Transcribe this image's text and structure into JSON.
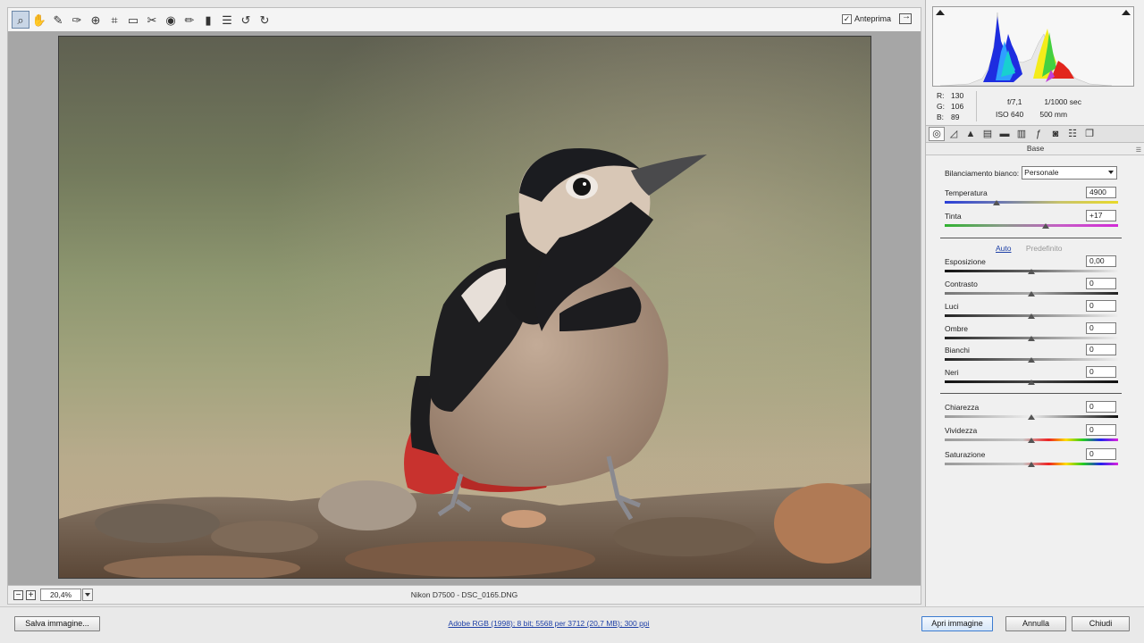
{
  "toolbar": {
    "tools": [
      {
        "name": "zoom-tool-icon",
        "glyph": "⌕",
        "active": true
      },
      {
        "name": "hand-tool-icon",
        "glyph": "✋"
      },
      {
        "name": "white-balance-tool-icon",
        "glyph": "✎"
      },
      {
        "name": "color-sampler-tool-icon",
        "glyph": "✑"
      },
      {
        "name": "targeted-adjustment-tool-icon",
        "glyph": "⊕"
      },
      {
        "name": "crop-tool-icon",
        "glyph": "⌗"
      },
      {
        "name": "straighten-tool-icon",
        "glyph": "▭"
      },
      {
        "name": "spot-removal-tool-icon",
        "glyph": "✂"
      },
      {
        "name": "red-eye-removal-tool-icon",
        "glyph": "◉"
      },
      {
        "name": "adjustment-brush-tool-icon",
        "glyph": "✏"
      },
      {
        "name": "graduated-filter-tool-icon",
        "glyph": "▮"
      },
      {
        "name": "preferences-icon",
        "glyph": "☰"
      },
      {
        "name": "rotate-left-icon",
        "glyph": "↺"
      },
      {
        "name": "rotate-right-icon",
        "glyph": "↻"
      }
    ],
    "preview_label": "Anteprima",
    "preview_checked": "✓"
  },
  "status": {
    "zoom_out": "−",
    "zoom_in": "+",
    "zoom_value": "20,4%",
    "file_caption": "Nikon D7500  -  DSC_0165.DNG"
  },
  "histogram": {
    "r_label": "R:",
    "r_value": "130",
    "g_label": "G:",
    "g_value": "106",
    "b_label": "B:",
    "b_value": "89",
    "aperture": "f/7,1",
    "shutter": "1/1000 sec",
    "iso": "ISO 640",
    "focal": "500 mm"
  },
  "panel_tabs": [
    {
      "name": "basic-tab-icon",
      "glyph": "◎",
      "active": true
    },
    {
      "name": "tone-curve-tab-icon",
      "glyph": "◿"
    },
    {
      "name": "detail-tab-icon",
      "glyph": "▲"
    },
    {
      "name": "hsl-tab-icon",
      "glyph": "▤"
    },
    {
      "name": "split-toning-tab-icon",
      "glyph": "▬"
    },
    {
      "name": "lens-corrections-tab-icon",
      "glyph": "▥"
    },
    {
      "name": "effects-tab-icon",
      "glyph": "ƒ"
    },
    {
      "name": "camera-calibration-tab-icon",
      "glyph": "◙"
    },
    {
      "name": "presets-tab-icon",
      "glyph": "☷"
    },
    {
      "name": "snapshots-tab-icon",
      "glyph": "❐"
    }
  ],
  "panel": {
    "title": "Base",
    "menu_glyph": "☰",
    "wb_label": "Bilanciamento bianco:",
    "wb_value": "Personale",
    "auto_label": "Auto",
    "default_label": "Predefinito"
  },
  "sliders": {
    "temperatura": {
      "label": "Temperatura",
      "value": "4900",
      "position": 0.3
    },
    "tinta": {
      "label": "Tinta",
      "value": "+17",
      "position": 0.58
    },
    "esposizione": {
      "label": "Esposizione",
      "value": "0,00",
      "position": 0.5
    },
    "contrasto": {
      "label": "Contrasto",
      "value": "0",
      "position": 0.5
    },
    "luci": {
      "label": "Luci",
      "value": "0",
      "position": 0.5
    },
    "ombre": {
      "label": "Ombre",
      "value": "0",
      "position": 0.5
    },
    "bianchi": {
      "label": "Bianchi",
      "value": "0",
      "position": 0.5
    },
    "neri": {
      "label": "Neri",
      "value": "0",
      "position": 0.5
    },
    "chiarezza": {
      "label": "Chiarezza",
      "value": "0",
      "position": 0.5
    },
    "vividezza": {
      "label": "Vividezza",
      "value": "0",
      "position": 0.5
    },
    "saturazione": {
      "label": "Saturazione",
      "value": "0",
      "position": 0.5
    }
  },
  "bottom": {
    "save_label": "Salva immagine...",
    "workflow_link": "Adobe RGB (1998); 8 bit; 5568 per 3712 (20,7 MB); 300 ppi",
    "open_label": "Apri immagine",
    "cancel_label": "Annulla",
    "close_label": "Chiudi"
  }
}
